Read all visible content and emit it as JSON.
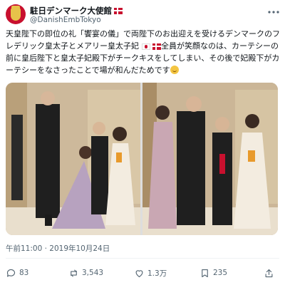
{
  "account": {
    "name": "駐日デンマーク大使館",
    "handle": "@DanishEmbTokyo"
  },
  "tweet": {
    "line1": "天皇陛下の即位の礼「饗宴の儀」で両陛下のお出迎えを受けるデンマークのフレデリック皇太子とメアリー皇太子妃",
    "line2": "全員が笑顔なのは、カーテシーの前に皇后陛下と皇太子妃殿下がチークキスをしてしまい、その後で妃殿下がカーテシーをなさったことで場が和んだためです"
  },
  "timestamp": "午前11:00 · 2019年10月24日",
  "actions": {
    "replies": "83",
    "retweets": "3,543",
    "likes": "1.3万",
    "bookmarks": "235"
  },
  "icons": {
    "reply": "comment-icon",
    "retweet": "retweet-icon",
    "like": "heart-icon",
    "bookmark": "bookmark-icon",
    "share": "share-icon",
    "more": "more-icon"
  },
  "colors": {
    "text": "#0f1419",
    "secondary": "#536471",
    "danish_red": "#c8102e"
  }
}
